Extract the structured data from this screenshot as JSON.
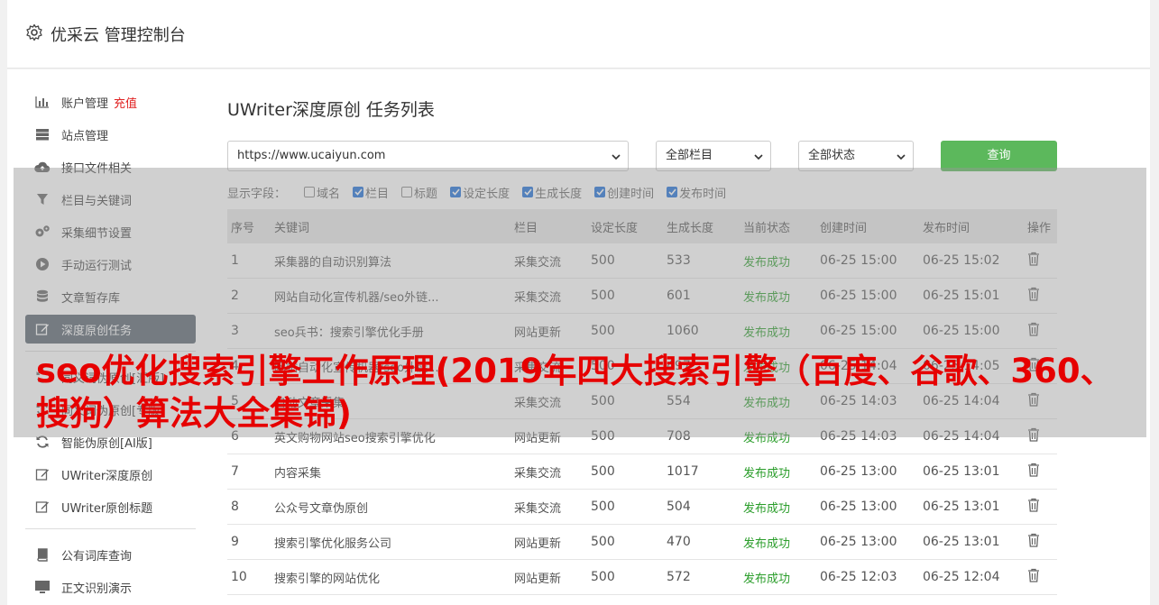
{
  "header": {
    "title": "优采云 管理控制台",
    "icon": "gear-icon"
  },
  "sidebar": {
    "recharge_tag": "充值",
    "items": [
      {
        "label": "账户管理",
        "icon": "bar-chart-icon"
      },
      {
        "label": "站点管理",
        "icon": "server-icon"
      },
      {
        "label": "接口文件相关",
        "icon": "cloud-upload-icon"
      },
      {
        "label": "栏目与关键词",
        "icon": "filter-icon"
      },
      {
        "label": "采集细节设置",
        "icon": "gears-icon"
      },
      {
        "label": "手动运行测试",
        "icon": "play-circle-icon"
      },
      {
        "label": "文章暂存库",
        "icon": "database-icon"
      },
      {
        "label": "深度原创任务",
        "icon": "edit-icon"
      },
      {
        "label": "同义词伪原创[汇版]",
        "icon": "refresh-icon"
      },
      {
        "label": "同义词伪原创[专版]",
        "icon": "refresh-icon"
      },
      {
        "label": "智能伪原创[AI版]",
        "icon": "refresh-icon"
      },
      {
        "label": "UWriter深度原创",
        "icon": "edit-icon"
      },
      {
        "label": "UWriter原创标题",
        "icon": "edit-icon"
      },
      {
        "label": "公有词库查询",
        "icon": "book-icon"
      },
      {
        "label": "正文识别演示",
        "icon": "monitor-icon"
      }
    ]
  },
  "main": {
    "title": "UWriter深度原创 任务列表",
    "site_select": "https://www.ucaiyun.com",
    "column_select": "全部栏目",
    "status_select": "全部状态",
    "query_label": "查询",
    "fields_label": "显示字段：",
    "fields": [
      {
        "label": "域名",
        "checked": false
      },
      {
        "label": "栏目",
        "checked": true
      },
      {
        "label": "标题",
        "checked": false
      },
      {
        "label": "设定长度",
        "checked": true
      },
      {
        "label": "生成长度",
        "checked": true
      },
      {
        "label": "创建时间",
        "checked": true
      },
      {
        "label": "发布时间",
        "checked": true
      }
    ],
    "columns": [
      "序号",
      "关键词",
      "栏目",
      "设定长度",
      "生成长度",
      "当前状态",
      "创建时间",
      "发布时间",
      "操作"
    ],
    "rows": [
      [
        "1",
        "采集器的自动识别算法",
        "采集交流",
        "500",
        "533",
        "发布成功",
        "06-25 15:00",
        "06-25 15:02"
      ],
      [
        "2",
        "网站自动化宣传机器/seo外链...",
        "采集交流",
        "500",
        "601",
        "发布成功",
        "06-25 15:00",
        "06-25 15:01"
      ],
      [
        "3",
        "seo兵书：搜索引擎优化手册",
        "网站更新",
        "500",
        "1060",
        "发布成功",
        "06-25 15:00",
        "06-25 15:00"
      ],
      [
        "4",
        "网站自动化宣传机器/seo外链...",
        "采集交流",
        "500",
        "497",
        "发布成功",
        "06-25 14:04",
        "06-25 14:05"
      ],
      [
        "5",
        "自动文章采集",
        "采集交流",
        "500",
        "554",
        "发布成功",
        "06-25 14:03",
        "06-25 14:04"
      ],
      [
        "6",
        "英文购物网站seo搜索引擎优化",
        "网站更新",
        "500",
        "708",
        "发布成功",
        "06-25 14:03",
        "06-25 14:04"
      ],
      [
        "7",
        "内容采集",
        "采集交流",
        "500",
        "1017",
        "发布成功",
        "06-25 13:00",
        "06-25 13:01"
      ],
      [
        "8",
        "公众号文章伪原创",
        "采集交流",
        "500",
        "504",
        "发布成功",
        "06-25 13:00",
        "06-25 13:01"
      ],
      [
        "9",
        "搜索引擎优化服务公司",
        "网站更新",
        "500",
        "470",
        "发布成功",
        "06-25 13:00",
        "06-25 13:01"
      ],
      [
        "10",
        "搜索引擎的网站优化",
        "网站更新",
        "500",
        "572",
        "发布成功",
        "06-25 12:03",
        "06-25 12:04"
      ]
    ],
    "delete_icon": "trash-icon"
  },
  "headline": "seo优化搜索引擎工作原理(2019年四大搜索引擎（百度、谷歌、360、搜狗）算法大全集锦)",
  "colors": {
    "active_bg": "#5a6470",
    "query_btn": "#5cb85c",
    "success": "#2a9d2a",
    "headline": "#e60000"
  }
}
